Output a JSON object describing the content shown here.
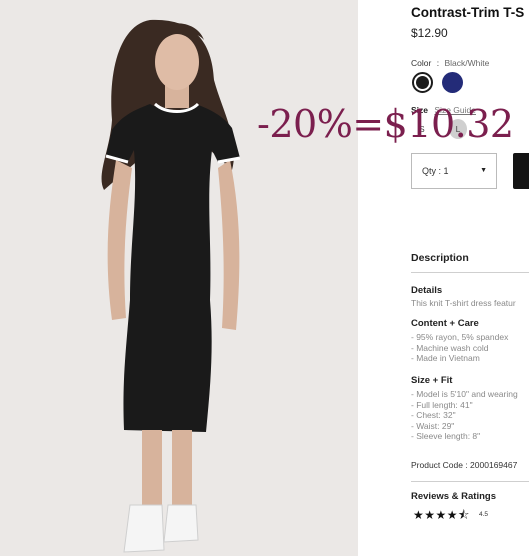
{
  "product": {
    "title": "Contrast-Trim T-S",
    "price": "$12.90"
  },
  "color": {
    "label": "Color",
    "separator": ":",
    "value": "Black/White",
    "swatches": [
      {
        "name": "black",
        "hex": "#1c1c1c",
        "selected": true
      },
      {
        "name": "navy",
        "hex": "#232b78",
        "selected": false
      }
    ]
  },
  "size": {
    "label": "Size",
    "guide_link": "Size Guide",
    "options": [
      "S",
      "L"
    ]
  },
  "quantity": {
    "label": "Qty : 1"
  },
  "description": {
    "heading": "Description",
    "details_heading": "Details",
    "details_text": "This knit T-shirt dress featur",
    "content_heading": "Content + Care",
    "content_lines": [
      "- 95% rayon, 5% spandex",
      "- Machine wash cold",
      "- Made in Vietnam"
    ],
    "fit_heading": "Size + Fit",
    "fit_lines": [
      "- Model is 5'10\" and wearing",
      "- Full length: 41\"",
      "- Chest: 32\"",
      "- Waist: 29\"",
      "- Sleeve length: 8\""
    ],
    "product_code": "Product Code : 2000169467"
  },
  "reviews": {
    "heading": "Reviews & Ratings",
    "stars": "★★★★⯪",
    "rating": "4.5"
  },
  "promo_overlay": "-20%=$10.32",
  "colors": {
    "promo": "#7b1f4e",
    "button": "#141414",
    "background": "#ebe8e6"
  }
}
